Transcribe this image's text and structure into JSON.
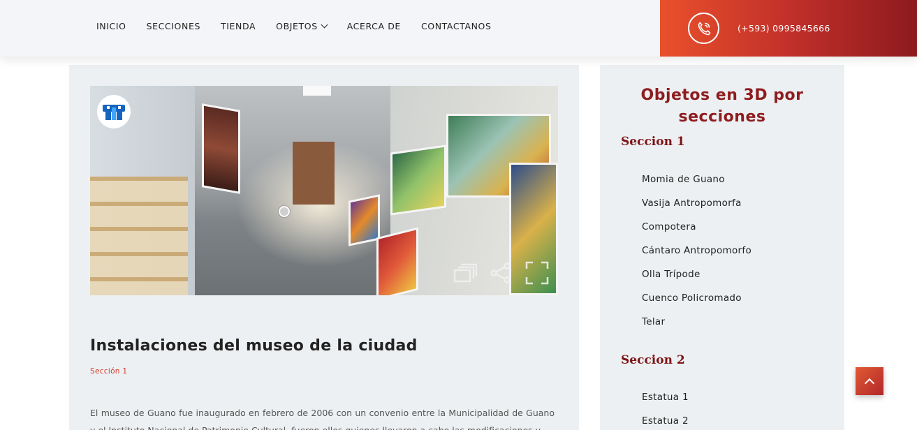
{
  "nav": {
    "items": [
      {
        "label": "INICIO"
      },
      {
        "label": "SECCIONES"
      },
      {
        "label": "TIENDA"
      },
      {
        "label": "OBJETOS"
      },
      {
        "label": "ACERCA DE"
      },
      {
        "label": "CONTACTANOS"
      }
    ],
    "phone": "(+593) 0995845666"
  },
  "post": {
    "title": "Instalaciones del museo de la ciudad",
    "category": "Sección 1",
    "text": "El museo de Guano fue inaugurado en febrero de 2006 con un convenio entre la Municipalidad de Guano y el Instituto Nacional de Patrimonio Cultural, fueron ellos quienes llevaron a cabo las modificaciones y"
  },
  "sidebar": {
    "title": "Objetos en 3D por secciones",
    "sections": [
      {
        "name": "Seccion 1",
        "items": [
          "Momia de Guano",
          "Vasija Antropomorfa",
          "Compotera",
          "Cántaro Antropomorfo",
          "Olla Trípode",
          "Cuenco Policromado",
          "Telar"
        ]
      },
      {
        "name": "Seccion 2",
        "items": [
          "Estatua 1",
          "Estatua 2"
        ]
      }
    ]
  },
  "colors": {
    "accent": "#8e1c1f",
    "phone_gradient_start": "#e9502b",
    "phone_gradient_end": "#8d1a1e",
    "category": "#d43a2a"
  },
  "icons": {
    "phone": "phone-icon",
    "chevron": "chevron-down-icon",
    "scroll_top": "arrow-up-icon",
    "tour_logo": "virtual-tour-logo-icon",
    "gallery": "gallery-icon",
    "share": "share-icon",
    "fullscreen": "fullscreen-icon"
  }
}
